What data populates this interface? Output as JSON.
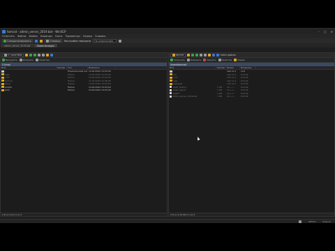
{
  "window": {
    "title": "tomcat - admin_server_2019.bat - WinSCP",
    "controls": [
      "–",
      "□",
      "✕"
    ]
  },
  "menu": [
    "Отметить",
    "Файлы",
    "Файлы",
    "Команды",
    "Сеанс",
    "Параметры",
    "Сервер",
    "Справка"
  ],
  "toolbar": {
    "sync_label": "Синхронизировать",
    "queue_label": "Очередь",
    "transfer_label": "Настройки передачи",
    "transfer_value": "По умолчанию"
  },
  "tabs": [
    {
      "label": "admin_server_2019.bat",
      "active": false
    },
    {
      "label": "Новая вкладка",
      "active": true
    }
  ],
  "left_panel": {
    "drive": "C: Local Disk",
    "actions": [
      "Выгрузить",
      "Изменить",
      "Свойства"
    ],
    "path": "C:\\tmp\\",
    "columns": [
      "Имя",
      "Размер",
      "Тип",
      "Изменено"
    ],
    "rows": [
      {
        "name": "..",
        "size": "",
        "type": "Родительский кат...",
        "modified": "14.02.2022 13:03:20",
        "kind": "up",
        "dim": false
      },
      {
        "name": "logs",
        "size": "",
        "type": "Папка",
        "modified": "14.02.2022 13:03:20",
        "kind": "folder",
        "dim": true
      },
      {
        "name": "conf",
        "size": "",
        "type": "Папка",
        "modified": "14.02.2022 13:03:20",
        "kind": "folder",
        "dim": true
      },
      {
        "name": "backup",
        "size": "",
        "type": "Папка",
        "modified": "11.01.2022 12:46:05",
        "kind": "folder",
        "dim": true
      },
      {
        "name": "temp",
        "size": "",
        "type": "Папка",
        "modified": "14.02.2022 13:03:20",
        "kind": "folder",
        "dim": true
      },
      {
        "name": "scripts",
        "size": "",
        "type": "Папка",
        "modified": "14.02.2022 13:03:20",
        "kind": "folder",
        "dim": false
      },
      {
        "name": "work",
        "size": "",
        "type": "Папка",
        "modified": "14.02.2022 13:03:20",
        "kind": "folder",
        "dim": false
      }
    ],
    "status": "0 B из 0 B в 0 из 5"
  },
  "right_panel": {
    "drive": "tomcat",
    "find_label": "Найти файлы",
    "actions": [
      "Загрузить",
      "Изменить",
      "Удалить",
      "Свойства",
      "Новый"
    ],
    "path": "/home/tomcat/",
    "columns": [
      "Имя",
      "Размер",
      "Права",
      "Владелец"
    ],
    "rows": [
      {
        "name": "..",
        "size": "",
        "rights": "rwxr-xr-x",
        "owner": "root",
        "kind": "up",
        "dim": false
      },
      {
        "name": "bin",
        "size": "",
        "rights": "rwxr-xr-x",
        "owner": "tomcat",
        "kind": "folder",
        "dim": true
      },
      {
        "name": "conf",
        "size": "",
        "rights": "rwxr-xr-x",
        "owner": "tomcat",
        "kind": "folder",
        "dim": true
      },
      {
        "name": "logs",
        "size": "",
        "rights": "rwxr-xr-x",
        "owner": "tomcat",
        "kind": "folder",
        "dim": true
      },
      {
        "name": "webapps",
        "size": "",
        "rights": "rwxr-xr-x",
        "owner": "tomcat",
        "kind": "folder",
        "dim": true
      },
      {
        "name": ".bash_history",
        "size": "1 KB",
        "rights": "rw-------",
        "owner": "tomcat",
        "kind": "file",
        "dim": true
      },
      {
        "name": ".bash_logout",
        "size": "1 KB",
        "rights": "rw-r--r--",
        "owner": "tomcat",
        "kind": "file",
        "dim": true
      },
      {
        "name": ".bashrc",
        "size": "1 KB",
        "rights": "rw-r--r--",
        "owner": "tomcat",
        "kind": "file",
        "dim": true
      },
      {
        "name": "admin_server_2019.bat",
        "size": "1 KB",
        "rights": "rw-r--r--",
        "owner": "tomcat",
        "kind": "file",
        "dim": true
      }
    ],
    "status": "0 B из 4,39 КВ в 0 из 8"
  },
  "statusbar": {
    "protocol": "SFTP-3",
    "elapsed": "0:04:17"
  }
}
